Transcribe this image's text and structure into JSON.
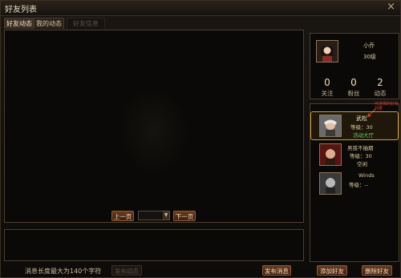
{
  "window": {
    "title": "好友列表"
  },
  "tabs": [
    {
      "label": "好友动态"
    },
    {
      "label": "我的动态"
    },
    {
      "label": "好友信息"
    }
  ],
  "pager": {
    "prev_label": "上一页",
    "next_label": "下一页",
    "page_value": ""
  },
  "compose": {
    "hint": "消息长度最大为140个字符",
    "button_disabled_label": "发布动态",
    "publish_label": "发布消息"
  },
  "profile": {
    "name": "小乔",
    "level": "30级",
    "stats": [
      {
        "value": "0",
        "label": "关注"
      },
      {
        "value": "0",
        "label": "粉丝"
      },
      {
        "value": "2",
        "label": "动态"
      }
    ]
  },
  "annotation": "可选择的好友列表",
  "friends": [
    {
      "name": "武松",
      "level": "等级：30",
      "status": "活动大厅"
    },
    {
      "name": "男孩不抽烟",
      "level": "等级：30",
      "status": "空闲"
    },
    {
      "name": "Winds",
      "level": "等级：--",
      "status": ""
    }
  ],
  "actions": {
    "add_label": "添加好友",
    "delete_label": "删除好友"
  },
  "colors": {
    "accent": "#c8a038",
    "button": "#6a3a22",
    "status_green": "#6fd05a"
  }
}
